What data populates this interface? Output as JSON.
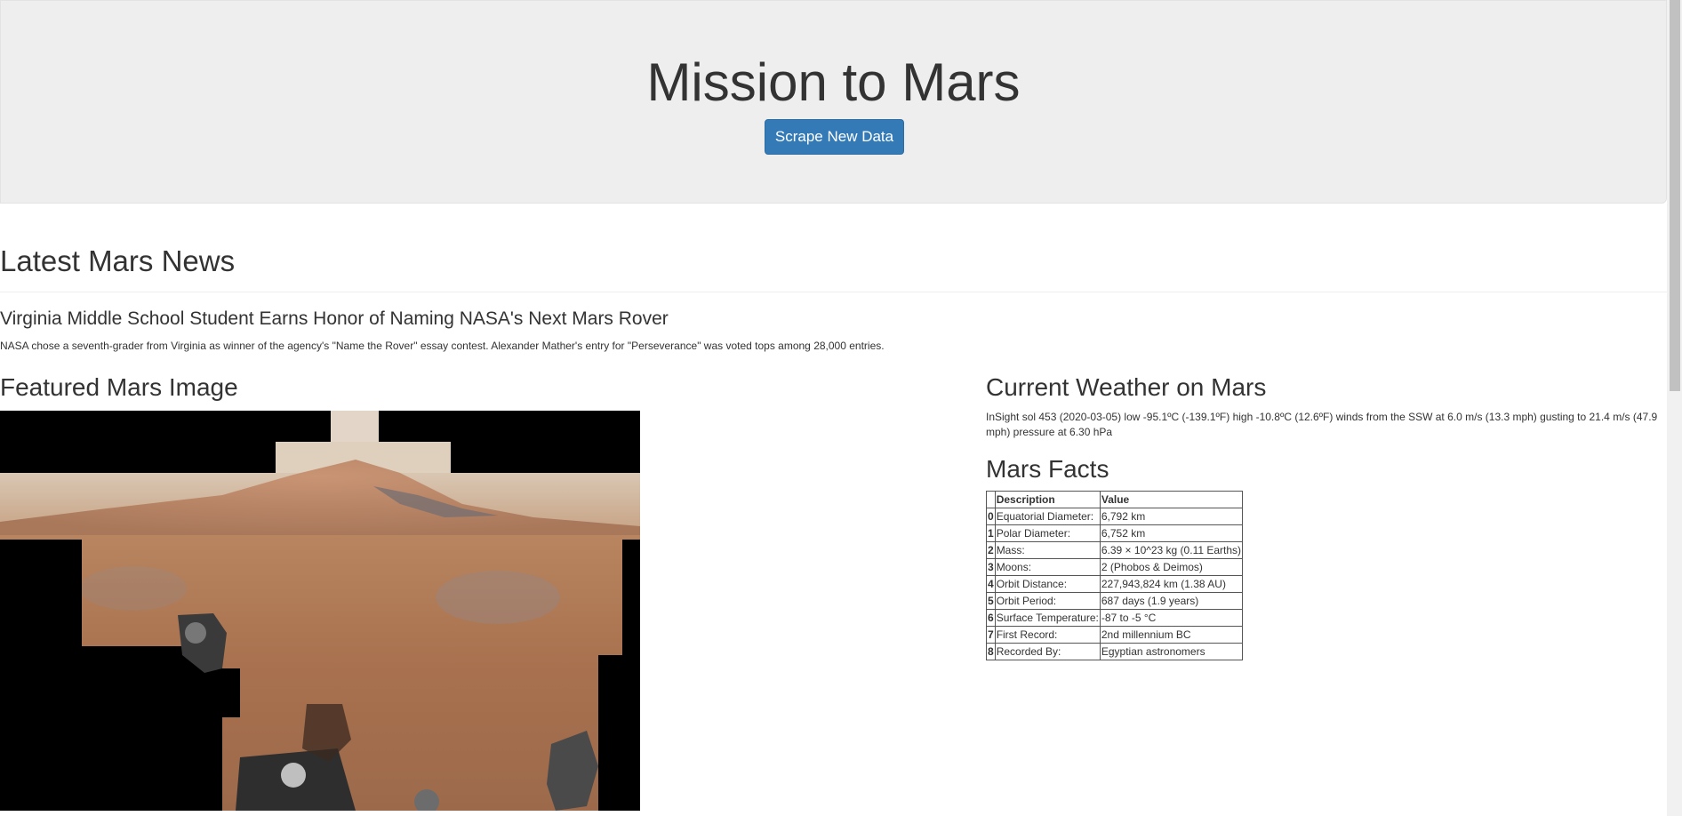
{
  "header": {
    "title": "Mission to Mars",
    "scrape_button": "Scrape New Data"
  },
  "news": {
    "heading": "Latest Mars News",
    "title": "Virginia Middle School Student Earns Honor of Naming NASA's Next Mars Rover",
    "paragraph": "NASA chose a seventh-grader from Virginia as winner of the agency's \"Name the Rover\" essay contest. Alexander Mather's entry for \"Perseverance\" was voted tops among 28,000 entries."
  },
  "featured": {
    "heading": "Featured Mars Image"
  },
  "weather": {
    "heading": "Current Weather on Mars",
    "text": "InSight sol 453 (2020-03-05) low -95.1ºC (-139.1ºF) high -10.8ºC (12.6ºF) winds from the SSW at 6.0 m/s (13.3 mph) gusting to 21.4 m/s (47.9 mph) pressure at 6.30 hPa"
  },
  "facts": {
    "heading": "Mars Facts",
    "columns": [
      "",
      "Description",
      "Value"
    ],
    "rows": [
      [
        "0",
        "Equatorial Diameter:",
        "6,792 km"
      ],
      [
        "1",
        "Polar Diameter:",
        "6,752 km"
      ],
      [
        "2",
        "Mass:",
        "6.39 × 10^23 kg (0.11 Earths)"
      ],
      [
        "3",
        "Moons:",
        "2 (Phobos & Deimos)"
      ],
      [
        "4",
        "Orbit Distance:",
        "227,943,824 km (1.38 AU)"
      ],
      [
        "5",
        "Orbit Period:",
        "687 days (1.9 years)"
      ],
      [
        "6",
        "Surface Temperature:",
        "-87 to -5 °C"
      ],
      [
        "7",
        "First Record:",
        "2nd millennium BC"
      ],
      [
        "8",
        "Recorded By:",
        "Egyptian astronomers"
      ]
    ]
  },
  "colors": {
    "button": "#337ab7",
    "jumbotron": "#eeeeee"
  }
}
